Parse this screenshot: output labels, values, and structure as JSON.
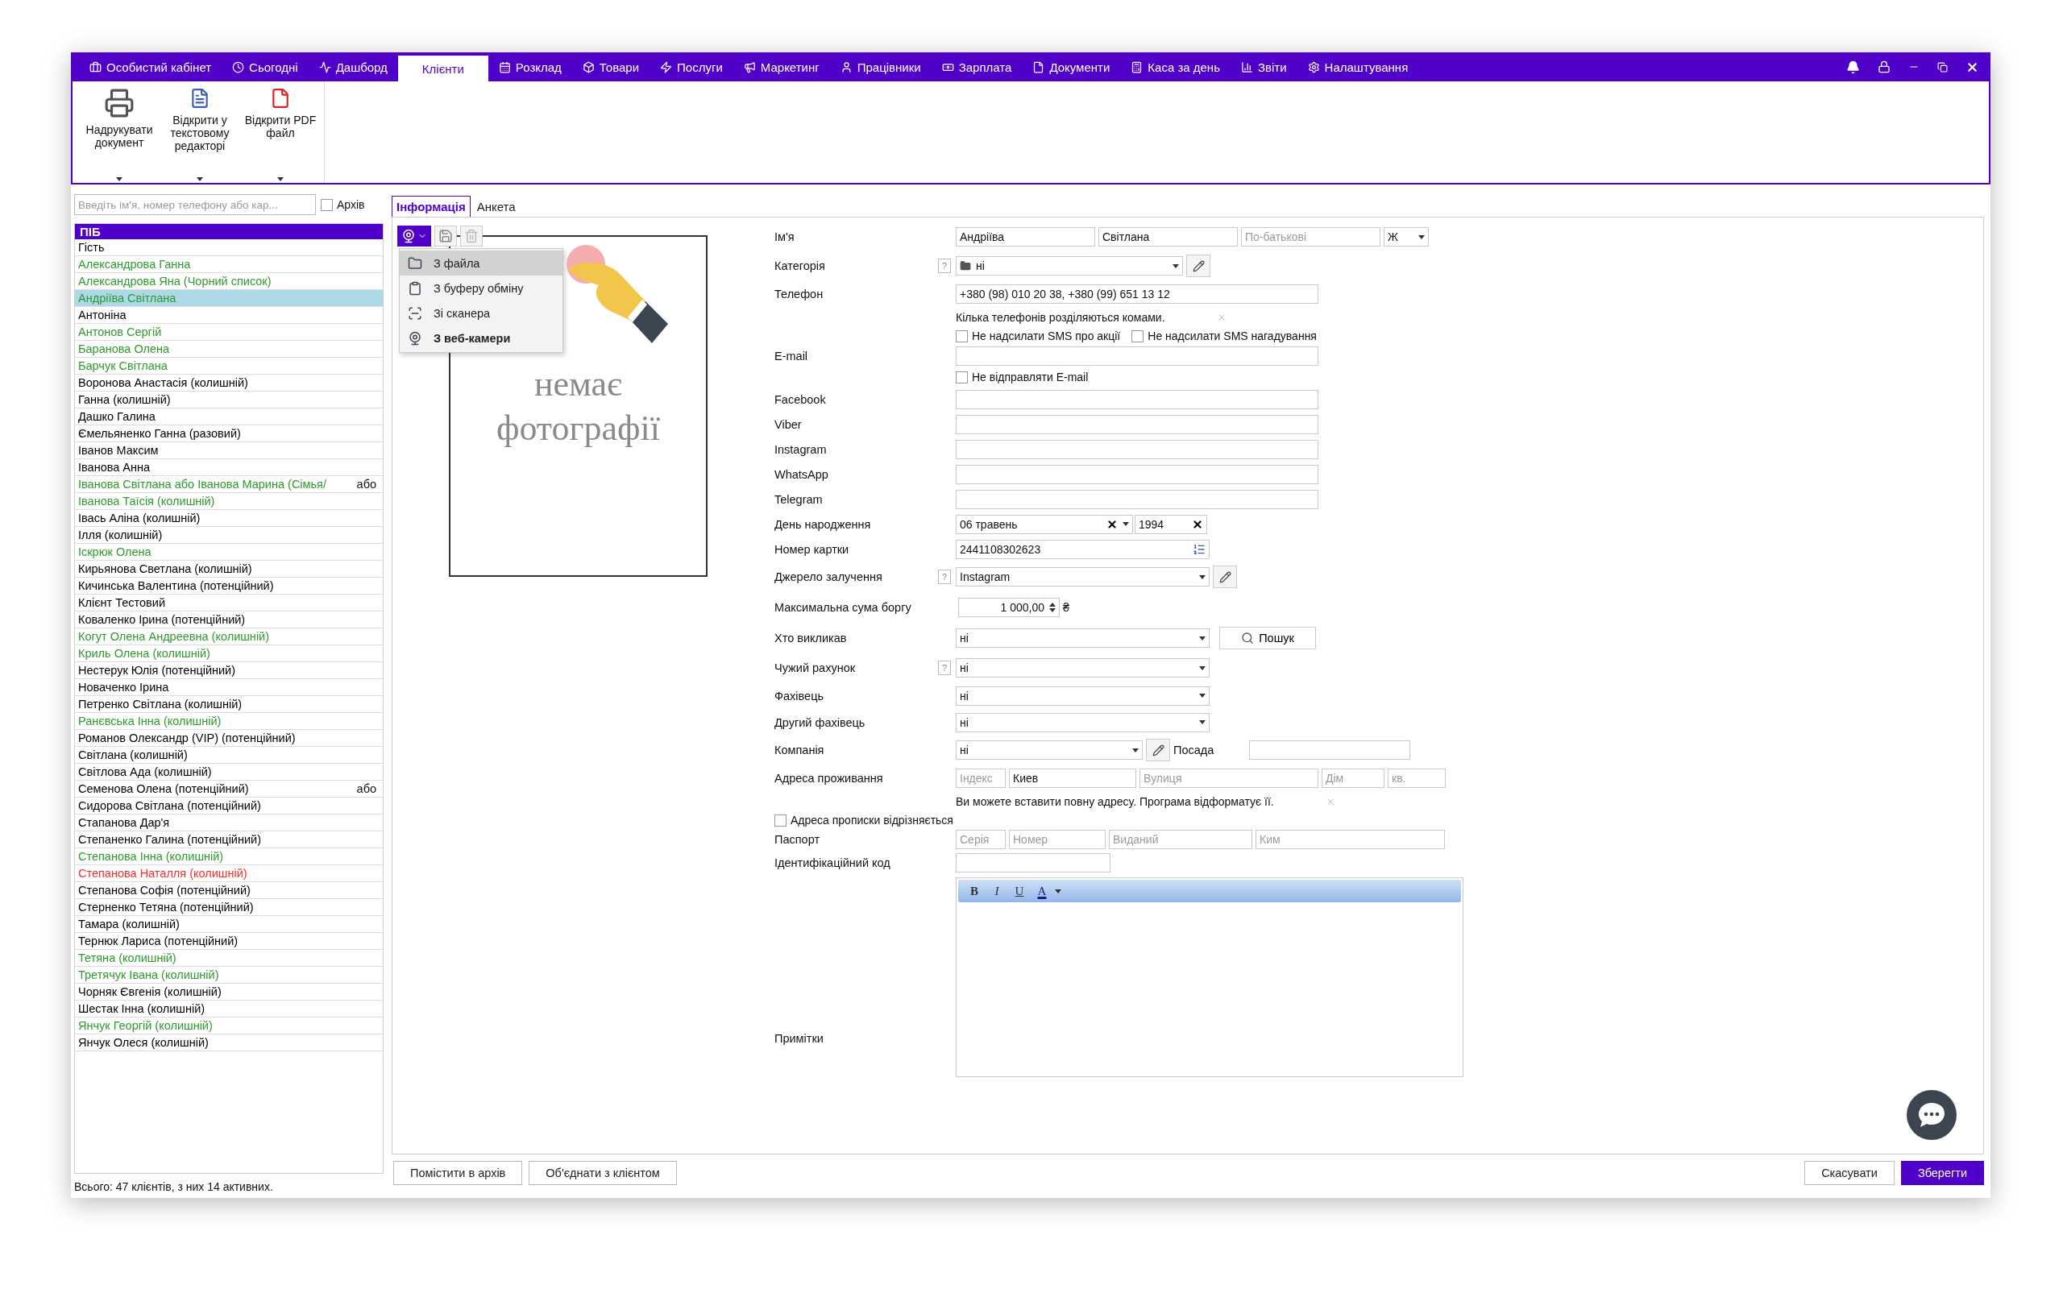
{
  "top_menu": [
    {
      "label": "Особистий кабінет",
      "selected": false
    },
    {
      "label": "Сьогодні",
      "selected": false
    },
    {
      "label": "Дашборд",
      "selected": false
    },
    {
      "label": "Клієнти",
      "selected": true
    },
    {
      "label": "Розклад",
      "selected": false
    },
    {
      "label": "Товари",
      "selected": false
    },
    {
      "label": "Послуги",
      "selected": false
    },
    {
      "label": "Маркетинг",
      "selected": false
    },
    {
      "label": "Працівники",
      "selected": false
    },
    {
      "label": "Зарплата",
      "selected": false
    },
    {
      "label": "Документи",
      "selected": false
    },
    {
      "label": "Каса за день",
      "selected": false
    },
    {
      "label": "Звіти",
      "selected": false
    },
    {
      "label": "Налаштування",
      "selected": false
    }
  ],
  "ribbon": [
    {
      "label": "Надрукувати документ"
    },
    {
      "label": "Відкрити у текстовому редакторі"
    },
    {
      "label": "Відкрити PDF файл"
    }
  ],
  "clients_panel": {
    "search": {
      "placeholder": "Введіть ім'я, номер телефону або кар..."
    },
    "archive": {
      "label": "Архів",
      "checked": false
    },
    "header": "ПІБ",
    "rows": [
      {
        "name": "Гість",
        "color": "#000000",
        "selected": false
      },
      {
        "name": "Александрова Ганна",
        "color": "#2e9a2e",
        "selected": false
      },
      {
        "name": "Александрова Яна (Чорний список)",
        "color": "#2e9a2e",
        "selected": false
      },
      {
        "name": "Андріїва Світлана",
        "color": "#2e9a2e",
        "selected": true
      },
      {
        "name": "Антоніна",
        "color": "#000000",
        "selected": false
      },
      {
        "name": "Антонов Сергій",
        "color": "#2e9a2e",
        "selected": false
      },
      {
        "name": "Баранова Олена",
        "color": "#2e9a2e",
        "selected": false
      },
      {
        "name": "Барчук Світлана",
        "color": "#2e9a2e",
        "selected": false
      },
      {
        "name": "Воронова Анастасія (колишній)",
        "color": "#000000",
        "selected": false
      },
      {
        "name": "Ганна (колишній)",
        "color": "#000000",
        "selected": false
      },
      {
        "name": "Дашко Галина",
        "color": "#000000",
        "selected": false
      },
      {
        "name": "Ємельяненко Ганна (разовий)",
        "color": "#000000",
        "selected": false
      },
      {
        "name": "Іванов Максим",
        "color": "#000000",
        "selected": false
      },
      {
        "name": "Іванова Анна",
        "color": "#000000",
        "selected": false
      },
      {
        "name": "Іванова Світлана  або Іванова  Марина (Сімья/",
        "color": "#2e9a2e",
        "selected": false,
        "note": "або"
      },
      {
        "name": "Іванова Таїсія (колишній)",
        "color": "#2e9a2e",
        "selected": false
      },
      {
        "name": "Івась Аліна (колишній)",
        "color": "#000000",
        "selected": false
      },
      {
        "name": "Ілля (колишній)",
        "color": "#000000",
        "selected": false
      },
      {
        "name": "Іскрюк Олена",
        "color": "#2e9a2e",
        "selected": false
      },
      {
        "name": "Кирьянова Светлана (колишній)",
        "color": "#000000",
        "selected": false
      },
      {
        "name": "Кичинська Валентина (потенційний)",
        "color": "#000000",
        "selected": false
      },
      {
        "name": "Клієнт Тестовий",
        "color": "#000000",
        "selected": false
      },
      {
        "name": "Коваленко Ірина (потенційний)",
        "color": "#000000",
        "selected": false
      },
      {
        "name": "Когут Олена Андреевна (колишній)",
        "color": "#2e9a2e",
        "selected": false
      },
      {
        "name": "Криль Олена (колишній)",
        "color": "#2e9a2e",
        "selected": false
      },
      {
        "name": "Нестерук Юлія (потенційний)",
        "color": "#000000",
        "selected": false
      },
      {
        "name": "Новаченко Ірина",
        "color": "#000000",
        "selected": false
      },
      {
        "name": "Петренко Світлана (колишній)",
        "color": "#000000",
        "selected": false
      },
      {
        "name": "Ранєвська Інна (колишній)",
        "color": "#2e9a2e",
        "selected": false
      },
      {
        "name": "Романов Олександр (VIP) (потенційний)",
        "color": "#000000",
        "selected": false
      },
      {
        "name": "Світлана (колишній)",
        "color": "#000000",
        "selected": false
      },
      {
        "name": "Світлова Ада (колишній)",
        "color": "#000000",
        "selected": false
      },
      {
        "name": "Семенова Олена (потенційний)",
        "color": "#000000",
        "selected": false,
        "note": "або"
      },
      {
        "name": "Сидорова Світлана (потенційний)",
        "color": "#000000",
        "selected": false
      },
      {
        "name": "Стапанова Дар'я",
        "color": "#000000",
        "selected": false
      },
      {
        "name": "Степаненко Галина (потенційний)",
        "color": "#000000",
        "selected": false
      },
      {
        "name": "Степанова Інна (колишній)",
        "color": "#2e9a2e",
        "selected": false
      },
      {
        "name": "Степанова Наталля (колишній)",
        "color": "#ff2a2a",
        "selected": false
      },
      {
        "name": "Степанова Софія (потенційний)",
        "color": "#000000",
        "selected": false
      },
      {
        "name": "Стерненко Тетяна (потенційний)",
        "color": "#000000",
        "selected": false
      },
      {
        "name": "Тамара (колишній)",
        "color": "#000000",
        "selected": false
      },
      {
        "name": "Тернюк Лариса (потенційний)",
        "color": "#000000",
        "selected": false
      },
      {
        "name": "Тетяна (колишній)",
        "color": "#2e9a2e",
        "selected": false
      },
      {
        "name": "Третячук Івана (колишній)",
        "color": "#2e9a2e",
        "selected": false
      },
      {
        "name": "Чорняк Євгенія (колишній)",
        "color": "#000000",
        "selected": false
      },
      {
        "name": "Шестак Інна (колишній)",
        "color": "#000000",
        "selected": false
      },
      {
        "name": "Янчук Георгій (колишній)",
        "color": "#2e9a2e",
        "selected": false
      },
      {
        "name": "Янчук Олеся (колишній)",
        "color": "#000000",
        "selected": false
      }
    ],
    "footer": "Всього: 47 клієнтів, з них 14 активних."
  },
  "tabs": [
    {
      "label": "Інформація",
      "selected": true
    },
    {
      "label": "Анкета",
      "selected": false
    }
  ],
  "photo": {
    "placeholder": "немає фотографії",
    "menu": [
      {
        "label": "З файла",
        "selected": true,
        "default": false
      },
      {
        "label": "З буферу обміну",
        "selected": false,
        "default": false
      },
      {
        "label": "Зі сканера",
        "selected": false,
        "default": false
      },
      {
        "label": "З веб-камери",
        "selected": false,
        "default": true
      }
    ]
  },
  "form": {
    "name": {
      "label": "Ім'я",
      "last": "Андріїва",
      "first": "Світлана",
      "middle_placeholder": "По-батькові",
      "gender": "Ж"
    },
    "category": {
      "label": "Категорія",
      "help": "?",
      "value": "ні"
    },
    "phone": {
      "label": "Телефон",
      "value": "+380 (98) 010 20 38, +380 (99) 651 13 12",
      "hint": "Кілька телефонів розділяються комами."
    },
    "sms": [
      {
        "label": "Не надсилати SMS про акції",
        "checked": false
      },
      {
        "label": "Не надсилати SMS нагадування",
        "checked": false
      }
    ],
    "email": {
      "label": "E-mail",
      "no_email": {
        "label": "Не відправляти E-mail",
        "checked": false
      }
    },
    "socials": [
      {
        "label": "Facebook"
      },
      {
        "label": "Viber"
      },
      {
        "label": "Instagram"
      },
      {
        "label": "WhatsApp"
      },
      {
        "label": "Telegram"
      }
    ],
    "birthday": {
      "label": "День народження",
      "day": "06  травень",
      "year": "1994"
    },
    "card": {
      "label": "Номер картки",
      "value": "2441108302623"
    },
    "source": {
      "label": "Джерело залучення",
      "help": "?",
      "value": "Instagram"
    },
    "max_debt": {
      "label": "Максимальна сума боргу",
      "value": "1 000,00",
      "currency": "₴"
    },
    "referrer": {
      "label": "Хто викликав",
      "value": "ні",
      "search_button": "Пошук"
    },
    "foreign_account": {
      "label": "Чужий рахунок",
      "help": "?",
      "value": "ні"
    },
    "specialist": {
      "label": "Фахівець",
      "value": "ні"
    },
    "second_specialist": {
      "label": "Другий фахівець",
      "value": "ні"
    },
    "company": {
      "label": "Компанія",
      "value": "ні",
      "position_label": "Посада"
    },
    "address": {
      "label": "Адреса проживання",
      "index_placeholder": "Індекс",
      "city": "Киев",
      "street_placeholder": "Вулиця",
      "house_placeholder": "Дім",
      "apt_placeholder": "кв.",
      "hint": "Ви можете вставити повну адресу. Програма відформатує її."
    },
    "registered_address": {
      "label": "Адреса прописки відрізняється",
      "checked": false
    },
    "passport": {
      "label": "Паспорт",
      "placeholders": [
        "Серія",
        "Номер",
        "Виданий",
        "Ким"
      ]
    },
    "tax_id": {
      "label": "Ідентифікаційний код"
    },
    "notes": {
      "label": "Примітки",
      "tools": [
        "B",
        "I",
        "U",
        "A"
      ]
    }
  },
  "actions_left": [
    "Помістити в архів",
    "Об'єднати з клієнтом"
  ],
  "actions_right": [
    {
      "label": "Скасувати",
      "primary": false
    },
    {
      "label": "Зберегти",
      "primary": true
    }
  ]
}
